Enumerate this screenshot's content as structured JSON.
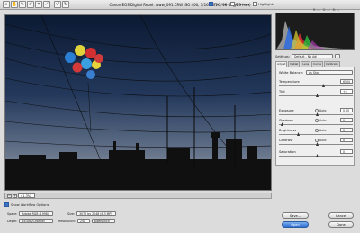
{
  "window": {
    "title": "Canon EOS Digital Rebel: www_091.CRW  ISO 400, 1/160, f/20, 18-55@25 mm)"
  },
  "toolbar": {
    "tools": [
      "zoom-tool",
      "hand-tool",
      "white-balance-tool",
      "color-sampler-tool",
      "crop-tool",
      "straighten-tool",
      "rotate-left",
      "rotate-right"
    ],
    "preview_label": "Preview",
    "preview_checked": true,
    "shadows_label": "Shadows",
    "shadows_checked": false,
    "highlights_label": "Highlights",
    "highlights_checked": false
  },
  "histogram": {
    "r_label": "R: ---",
    "g_label": "G: ---",
    "b_label": "B: ---"
  },
  "settings": {
    "label": "Settings:",
    "value": "Default - No Adj"
  },
  "tabs": [
    "Adjust",
    "Detail",
    "Lens",
    "Curve",
    "Calibrate"
  ],
  "adjust": {
    "white_balance_label": "White Balance:",
    "white_balance_value": "As Shot",
    "temperature_label": "Temperature",
    "temperature_value": "6500",
    "tint_label": "Tint",
    "tint_value": "+4",
    "exposure_label": "Exposure",
    "exposure_auto": "Auto",
    "exposure_value": "0.00",
    "shadows_label": "Shadows",
    "shadows_auto": "Auto",
    "shadows_value": "0",
    "brightness_label": "Brightness",
    "brightness_auto": "Auto",
    "brightness_value": "0",
    "contrast_label": "Contrast",
    "contrast_auto": "Auto",
    "contrast_value": "0",
    "saturation_label": "Saturation",
    "saturation_value": "0"
  },
  "zoom": {
    "value": "41.3%"
  },
  "workflow": {
    "toggle_label": "Show Workflow Options",
    "space_label": "Space:",
    "space_value": "Adobe RGB (1998)",
    "depth_label": "Depth:",
    "depth_value": "16 Bits/Channel",
    "size_label": "Size:",
    "size_value": "3072 by 2048 (6.3 MP)",
    "resolution_label": "Resolution:",
    "resolution_value": "240",
    "resolution_unit": "pixels/inch"
  },
  "buttons": {
    "save": "Save...",
    "open": "Open",
    "cancel": "Cancel",
    "done": "Done"
  }
}
